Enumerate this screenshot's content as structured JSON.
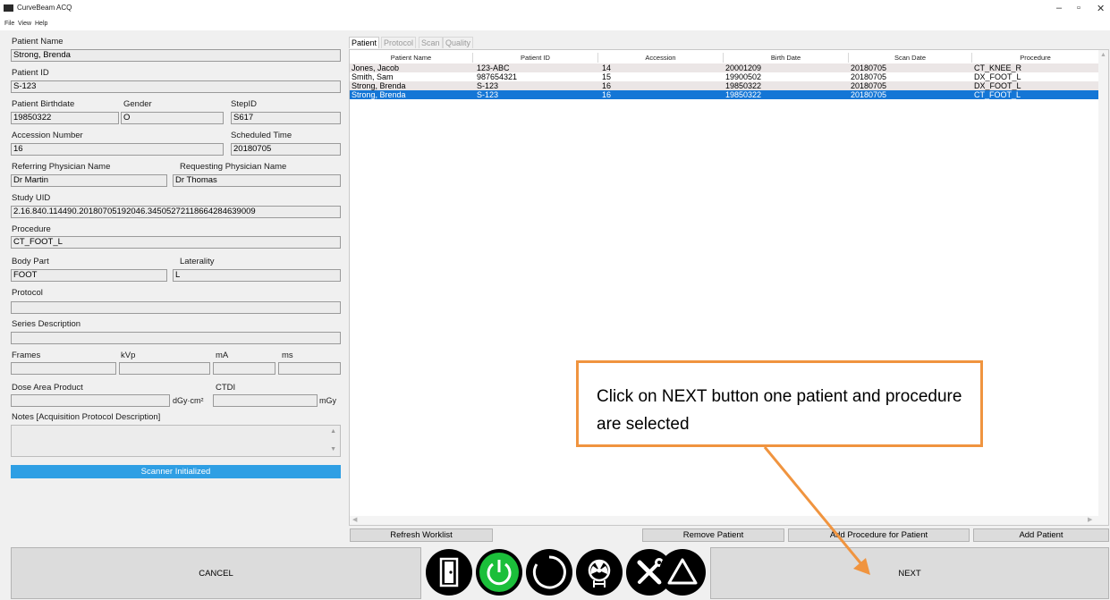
{
  "window": {
    "title": "CurveBeam ACQ",
    "controls": {
      "minimize": "–",
      "maximize": "▫",
      "close": "✕"
    }
  },
  "menu": [
    "File",
    "View",
    "Help"
  ],
  "form": {
    "patient_name_label": "Patient Name",
    "patient_name": "Strong, Brenda",
    "patient_id_label": "Patient ID",
    "patient_id": "S-123",
    "birthdate_label": "Patient Birthdate",
    "birthdate": "19850322",
    "gender_label": "Gender",
    "gender": "O",
    "stepid_label": "StepID",
    "stepid": "S617",
    "accession_label": "Accession Number",
    "accession": "16",
    "scheduled_label": "Scheduled Time",
    "scheduled": "20180705",
    "referring_label": "Referring Physician Name",
    "referring": "Dr Martin",
    "requesting_label": "Requesting Physician Name",
    "requesting": "Dr Thomas",
    "study_uid_label": "Study UID",
    "study_uid": "2.16.840.114490.20180705192046.34505272118664284639009",
    "procedure_label": "Procedure",
    "procedure": "CT_FOOT_L",
    "body_part_label": "Body Part",
    "body_part": "FOOT",
    "laterality_label": "Laterality",
    "laterality": "L",
    "protocol_label": "Protocol",
    "protocol": "",
    "series_label": "Series Description",
    "series": "",
    "frames_label": "Frames",
    "kvp_label": "kVp",
    "ma_label": "mA",
    "ms_label": "ms",
    "dap_label": "Dose Area Product",
    "dap_unit": "dGy·cm²",
    "ctdi_label": "CTDI",
    "ctdi_unit": "mGy",
    "notes_label": "Notes [Acquisition Protocol Description]",
    "status": "Scanner Initialized"
  },
  "tabs": [
    "Patient",
    "Protocol",
    "Scan",
    "Quality"
  ],
  "worklist": {
    "columns": [
      "Patient Name",
      "Patient ID",
      "Accession",
      "Birth Date",
      "Scan Date",
      "Procedure"
    ],
    "rows": [
      [
        "Jones, Jacob",
        "123-ABC",
        "14",
        "20001209",
        "20180705",
        "CT_KNEE_R"
      ],
      [
        "Smith, Sam",
        "987654321",
        "15",
        "19900502",
        "20180705",
        "DX_FOOT_L"
      ],
      [
        "Strong, Brenda",
        "S-123",
        "16",
        "19850322",
        "20180705",
        "DX_FOOT_L"
      ],
      [
        "Strong, Brenda",
        "S-123",
        "16",
        "19850322",
        "20180705",
        "CT_FOOT_L"
      ]
    ]
  },
  "buttons": {
    "refresh": "Refresh Worklist",
    "remove": "Remove Patient",
    "add_procedure": "Add Procedure for Patient",
    "add_patient": "Add Patient",
    "cancel": "CANCEL",
    "next": "NEXT"
  },
  "callout": {
    "text": "Click on NEXT button one patient and procedure are selected"
  },
  "colors": {
    "selection": "#1476d6",
    "status": "#2f9fe4",
    "callout_border": "#f0943f",
    "power_green": "#1bbf3a"
  },
  "icons": [
    "door-exit-icon",
    "power-icon",
    "spinner-icon",
    "radiation-icon",
    "tools-icon",
    "warning-icon"
  ]
}
